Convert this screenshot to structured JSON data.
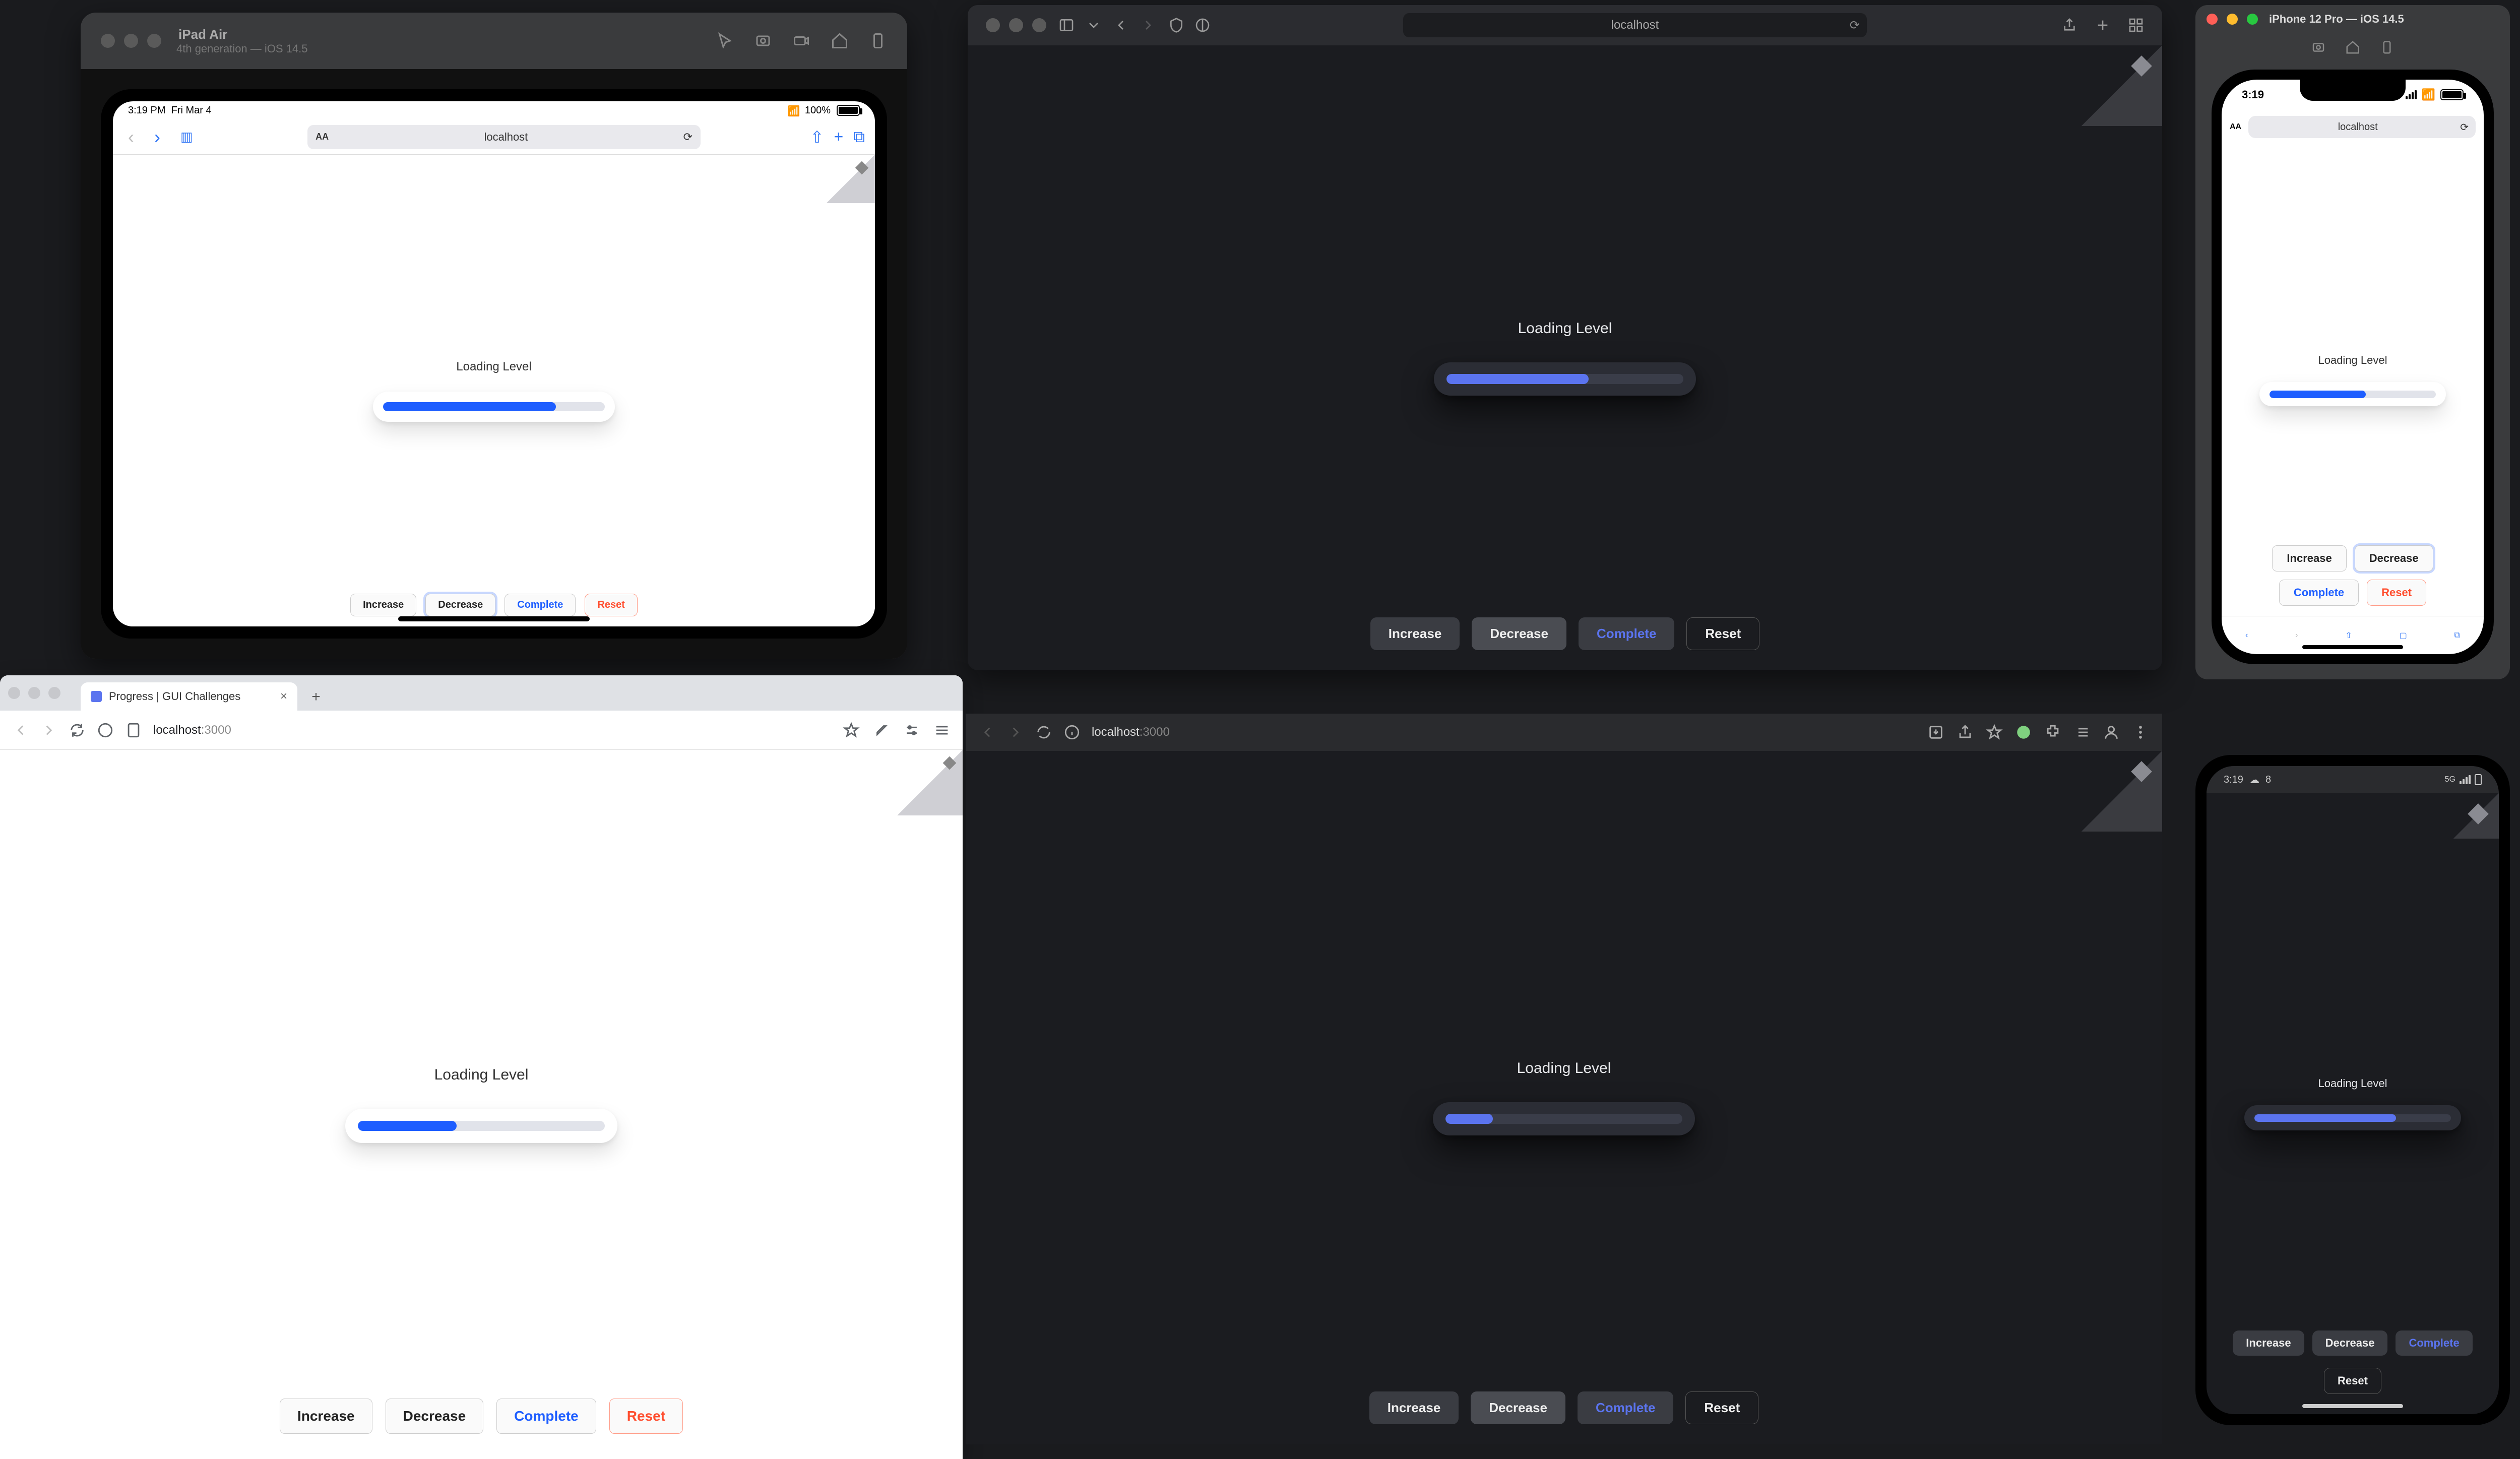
{
  "devices": {
    "ipad": {
      "window_title": "iPad Air",
      "window_subtitle": "4th generation — iOS 14.5",
      "status_time": "3:19 PM",
      "status_date": "Fri Mar 4",
      "status_wifi": "100%",
      "url_host": "localhost",
      "progress_label": "Loading Level",
      "progress_pct": 78,
      "buttons": {
        "increase": "Increase",
        "decrease": "Decrease",
        "complete": "Complete",
        "reset": "Reset"
      },
      "active_button": "decrease"
    },
    "safari_desktop": {
      "url_host": "localhost",
      "progress_label": "Loading Level",
      "progress_pct": 60,
      "buttons": {
        "increase": "Increase",
        "decrease": "Decrease",
        "complete": "Complete",
        "reset": "Reset"
      },
      "active_button": "decrease"
    },
    "chrome_light": {
      "tab_title": "Progress | GUI Challenges",
      "url_host": "localhost",
      "url_port": ":3000",
      "progress_label": "Loading Level",
      "progress_pct": 40,
      "buttons": {
        "increase": "Increase",
        "decrease": "Decrease",
        "complete": "Complete",
        "reset": "Reset"
      }
    },
    "chrome_dark": {
      "url_host": "localhost",
      "url_port": ":3000",
      "progress_label": "Loading Level",
      "progress_pct": 20,
      "buttons": {
        "increase": "Increase",
        "decrease": "Decrease",
        "complete": "Complete",
        "reset": "Reset"
      }
    },
    "iphone": {
      "window_title": "iPhone 12 Pro — iOS 14.5",
      "status_time": "3:19",
      "url_host": "localhost",
      "progress_label": "Loading Level",
      "progress_pct": 58,
      "buttons": {
        "increase": "Increase",
        "decrease": "Decrease",
        "complete": "Complete",
        "reset": "Reset"
      },
      "active_button": "decrease"
    },
    "android": {
      "status_time": "3:19",
      "status_temp": "8",
      "progress_label": "Loading Level",
      "progress_pct": 72,
      "buttons": {
        "increase": "Increase",
        "decrease": "Decrease",
        "complete": "Complete",
        "reset": "Reset"
      }
    }
  },
  "colors": {
    "accent_light": "#1e5eff",
    "accent_dark": "#5b74ef",
    "danger": "#ff4d2e"
  }
}
